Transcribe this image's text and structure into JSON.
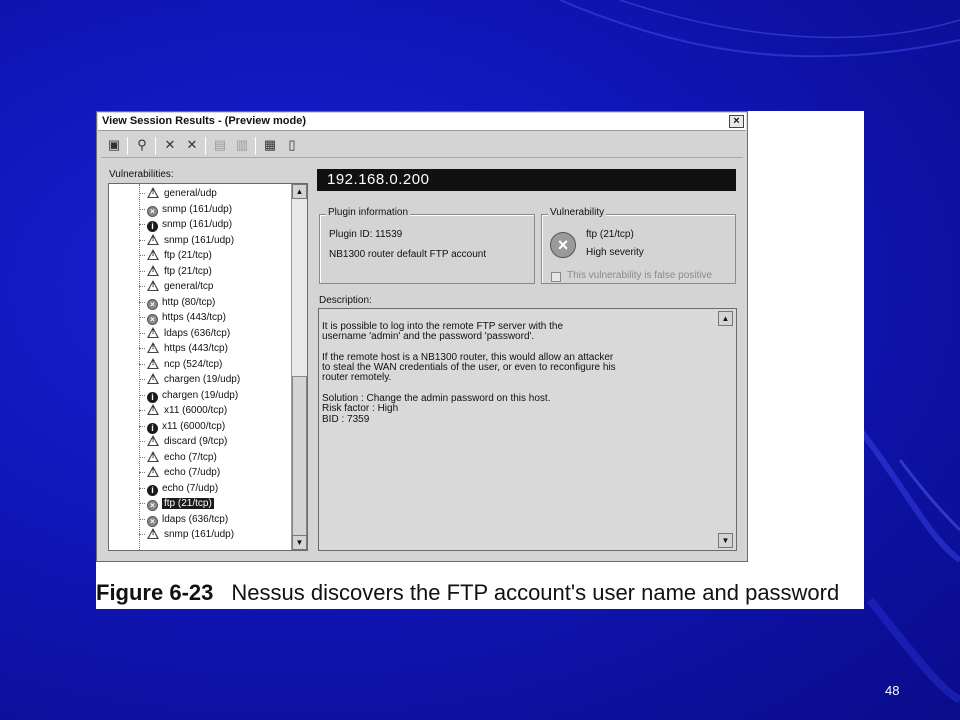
{
  "window": {
    "title": "View Session Results -  (Preview mode)",
    "close_glyph": "×"
  },
  "toolbar": {
    "buttons": [
      {
        "name": "save-icon",
        "glyph": "▣"
      },
      {
        "name": "find-icon",
        "glyph": "⚲"
      },
      {
        "name": "delete-icon",
        "glyph": "✕"
      },
      {
        "name": "delete-all-icon",
        "glyph": "✕"
      },
      {
        "name": "export-icon",
        "glyph": "▤"
      },
      {
        "name": "report-icon",
        "glyph": "▥"
      },
      {
        "name": "filter-icon",
        "glyph": "▦"
      },
      {
        "name": "exit-icon",
        "glyph": "▯"
      }
    ]
  },
  "tree": {
    "label": "Vulnerabilities:",
    "items": [
      {
        "text": "general/udp",
        "icon": "warning-icon"
      },
      {
        "text": "snmp (161/udp)",
        "icon": "security-hole-icon"
      },
      {
        "text": "snmp (161/udp)",
        "icon": "info-icon"
      },
      {
        "text": "snmp (161/udp)",
        "icon": "warning-icon"
      },
      {
        "text": "ftp (21/tcp)",
        "icon": "warning-icon"
      },
      {
        "text": "ftp (21/tcp)",
        "icon": "warning-icon"
      },
      {
        "text": "general/tcp",
        "icon": "warning-icon"
      },
      {
        "text": "http (80/tcp)",
        "icon": "security-hole-icon"
      },
      {
        "text": "https (443/tcp)",
        "icon": "security-hole-icon"
      },
      {
        "text": "ldaps (636/tcp)",
        "icon": "warning-icon"
      },
      {
        "text": "https (443/tcp)",
        "icon": "warning-icon"
      },
      {
        "text": "ncp (524/tcp)",
        "icon": "warning-icon"
      },
      {
        "text": "chargen (19/udp)",
        "icon": "warning-icon"
      },
      {
        "text": "chargen (19/udp)",
        "icon": "info-icon"
      },
      {
        "text": "x11 (6000/tcp)",
        "icon": "warning-icon"
      },
      {
        "text": "x11 (6000/tcp)",
        "icon": "info-icon"
      },
      {
        "text": "discard (9/tcp)",
        "icon": "warning-icon"
      },
      {
        "text": "echo (7/tcp)",
        "icon": "warning-icon"
      },
      {
        "text": "echo (7/udp)",
        "icon": "warning-icon"
      },
      {
        "text": "echo (7/udp)",
        "icon": "info-icon"
      },
      {
        "text": "ftp (21/tcp)",
        "icon": "security-hole-icon",
        "selected": true
      },
      {
        "text": "ldaps (636/tcp)",
        "icon": "security-hole-icon"
      },
      {
        "text": "snmp (161/udp)",
        "icon": "warning-icon"
      }
    ]
  },
  "host": "192.168.0.200",
  "plugin_info": {
    "title": "Plugin information",
    "plugin_id": "Plugin ID: 11539",
    "name": "NB1300 router default FTP account"
  },
  "vulnerability": {
    "title": "Vulnerability",
    "port": "ftp (21/tcp)",
    "severity": "High severity",
    "false_positive_label": "This vulnerability is false positive",
    "false_positive_checked": false
  },
  "description": {
    "label": "Description:",
    "text": "It is possible to log into the remote FTP server with the\nusername 'admin' and the password 'password'.\n\nIf the remote host is a NB1300 router, this would allow an attacker\nto steal the WAN credentials of the user, or even to reconfigure his\nrouter remotely.\n\nSolution : Change the admin password on this host.\nRisk factor : High\nBID : 7359"
  },
  "caption": {
    "figure": "Figure 6-23",
    "text": "Nessus discovers the FTP account's user name and password"
  },
  "page_number": "48",
  "colors": {
    "slide_background": "#1016b8",
    "window_gray": "#d4d4d4",
    "ip_bar": "#111111"
  }
}
